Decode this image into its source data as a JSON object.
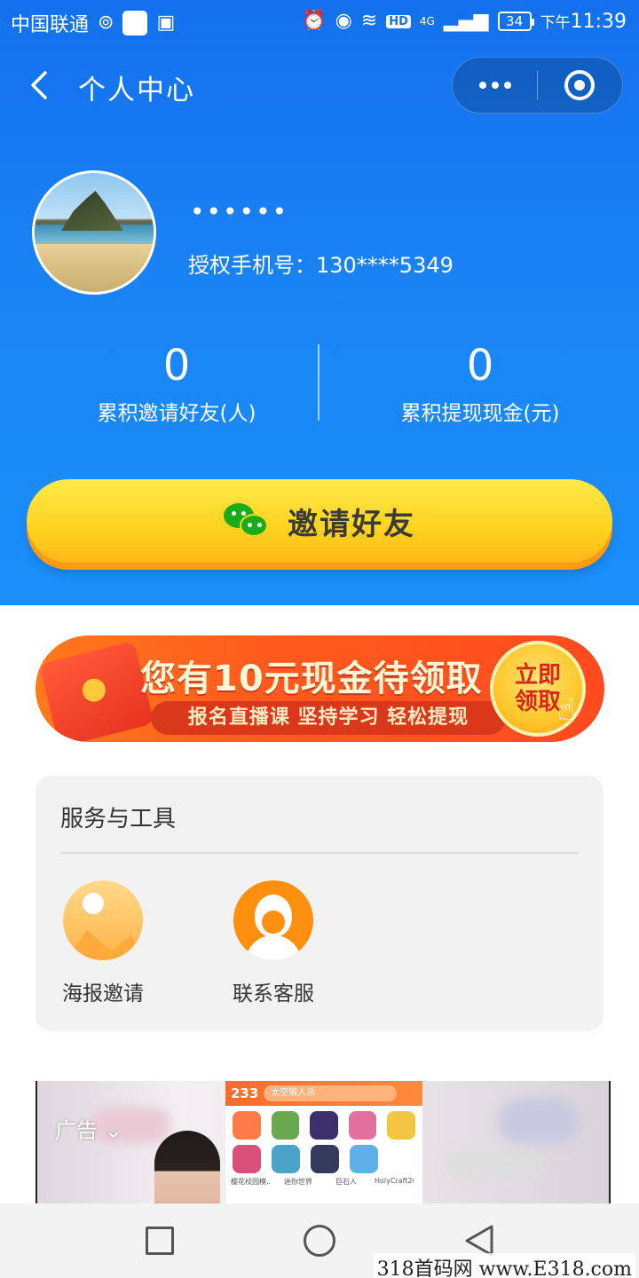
{
  "status_bar": {
    "carrier": "中国联通",
    "time_prefix": "下午",
    "time": "11:39",
    "battery": "34",
    "network": "4G",
    "hd": "HD"
  },
  "nav": {
    "title": "个人中心"
  },
  "profile": {
    "name": "••••••",
    "phone_label": "授权手机号：",
    "phone": "130****5349"
  },
  "stats": [
    {
      "value": "0",
      "label": "累积邀请好友(人)"
    },
    {
      "value": "0",
      "label": "累积提现现金(元)"
    }
  ],
  "invite_button": {
    "label": "邀请好友",
    "icon": "wechat-icon"
  },
  "promo": {
    "title": "您有10元现金待领取",
    "subtitle": "报名直播课 坚持学习 轻松提现",
    "claim_line1": "立即",
    "claim_line2": "领取"
  },
  "services": {
    "title": "服务与工具",
    "items": [
      {
        "label": "海报邀请",
        "icon": "image-icon"
      },
      {
        "label": "联系客服",
        "icon": "customer-service-icon"
      }
    ]
  },
  "ad": {
    "label": "广告",
    "brand": "233",
    "search_placeholder": "太空狼人杀",
    "apps": [
      "樱花校园模...",
      "迷你世界",
      "巨石人",
      "HolyCraft20..."
    ]
  },
  "watermark": "318首码网 www.E318.com",
  "colors": {
    "hero_blue": "#1a86f6",
    "invite_yellow": "#ffd31e",
    "promo_orange": "#ff5a1e",
    "service_orange": "#ff8f0f"
  }
}
